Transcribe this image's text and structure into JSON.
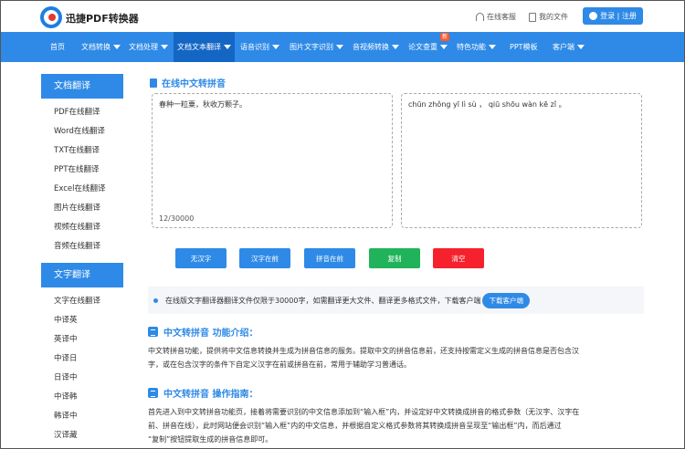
{
  "header": {
    "brand": "迅捷PDF转换器",
    "service": "在线客服",
    "my_files": "我的文件",
    "login": "登录 | 注册"
  },
  "nav": {
    "items": [
      "首页",
      "文档转换",
      "文档处理",
      "文档文本翻译",
      "语音识别",
      "图片文字识别",
      "音视频转换",
      "论文查重",
      "特色功能",
      "PPT模板",
      "客户端"
    ],
    "new_badge": "新"
  },
  "sidebar": {
    "sections": [
      {
        "title": "文档翻译",
        "items": [
          "PDF在线翻译",
          "Word在线翻译",
          "TXT在线翻译",
          "PPT在线翻译",
          "Excel在线翻译",
          "图片在线翻译",
          "视频在线翻译",
          "音频在线翻译"
        ]
      },
      {
        "title": "文字翻译",
        "items": [
          "文字在线翻译",
          "中译英",
          "英译中",
          "中译日",
          "日译中",
          "中译韩",
          "韩译中",
          "汉译藏"
        ]
      }
    ]
  },
  "main": {
    "title": "在线中文转拼音",
    "input_text": "春种一粒粟，秋收万颗子。",
    "counter": "12/30000",
    "output_text": "chūn zhǒng yī lì sù ，  qiū shōu wàn kē zǐ 。",
    "buttons": [
      {
        "label": "无汉字",
        "color": "#2e8ae6"
      },
      {
        "label": "汉字在前",
        "color": "#2e8ae6"
      },
      {
        "label": "拼音在前",
        "color": "#2e8ae6"
      },
      {
        "label": "复制",
        "color": "#21b35a"
      },
      {
        "label": "清空",
        "color": "#f5222d"
      }
    ],
    "notice": "在线版文字翻译器翻译文件仅限于30000字，如需翻译更大文件、翻译更多格式文件，下载客户端",
    "download_label": "下载客户端",
    "intro_title": "中文转拼音 功能介绍：",
    "intro_lines": [
      "中文转拼音功能，提供将中文信息转换并生成为拼音信息的服务。提取中文的拼音信息前，还支持按需定义生成的拼音信息是否包含汉",
      "字，或在包含汉字的条件下自定义汉字在前或拼音在前，常用于辅助学习普通话。"
    ],
    "guide_title": "中文转拼音 操作指南：",
    "guide_lines": [
      "首先进入到中文转拼音功能页，接着将需要识别的中文信息添加到“输入框”内，并设定好中文转换成拼音的格式参数（无汉字、汉字在",
      "前、拼音在线），此时网站便会识别“输入框”内的中文信息，并根据自定义格式参数将其转换成拼音呈现至“输出框”内，而后通过",
      "“复制”按钮提取生成的拼音信息即可。"
    ]
  }
}
